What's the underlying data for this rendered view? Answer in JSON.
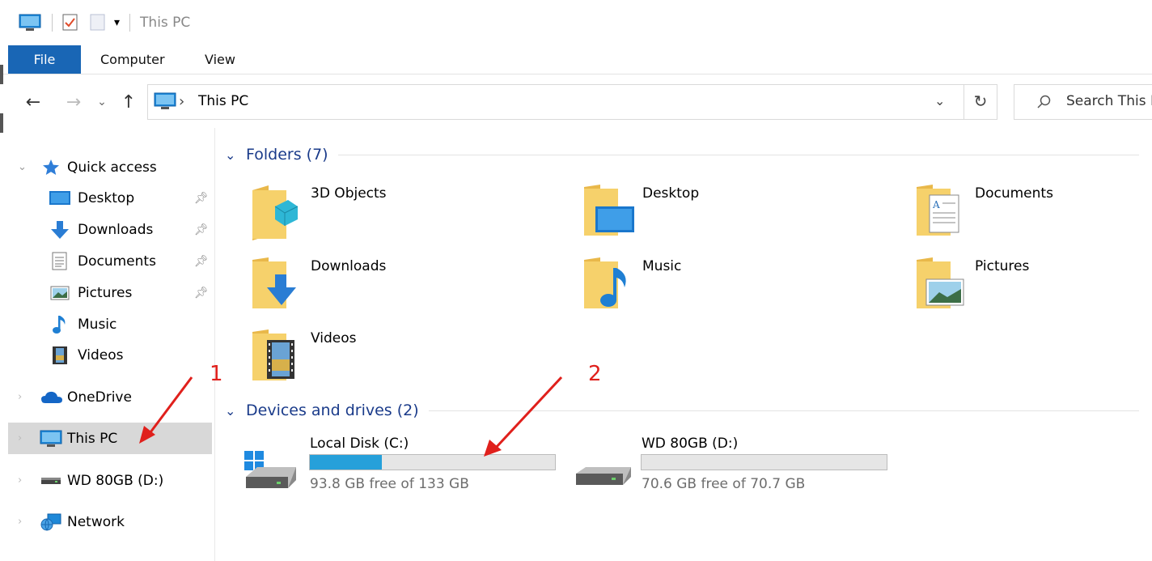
{
  "window": {
    "title": "This PC"
  },
  "ribbon": {
    "tabs": [
      "File",
      "Computer",
      "View"
    ]
  },
  "address": {
    "location": "This PC",
    "search_placeholder": "Search This PC"
  },
  "sidebar": {
    "quick_access": "Quick access",
    "quick_items": [
      {
        "label": "Desktop",
        "pinned": true,
        "icon": "desktop-icon"
      },
      {
        "label": "Downloads",
        "pinned": true,
        "icon": "downloads-icon"
      },
      {
        "label": "Documents",
        "pinned": true,
        "icon": "documents-icon"
      },
      {
        "label": "Pictures",
        "pinned": true,
        "icon": "pictures-icon"
      },
      {
        "label": "Music",
        "pinned": false,
        "icon": "music-icon"
      },
      {
        "label": "Videos",
        "pinned": false,
        "icon": "videos-icon"
      }
    ],
    "onedrive": "OneDrive",
    "this_pc": "This PC",
    "wd_drive": "WD 80GB (D:)",
    "network": "Network"
  },
  "content": {
    "folders_header": "Folders (7)",
    "folders": [
      "3D Objects",
      "Desktop",
      "Documents",
      "Downloads",
      "Music",
      "Pictures",
      "Videos"
    ],
    "devices_header": "Devices and drives (2)",
    "drives": [
      {
        "name": "Local Disk (C:)",
        "free_text": "93.8 GB free of 133 GB",
        "used_fraction": 0.295
      },
      {
        "name": "WD 80GB (D:)",
        "free_text": "70.6 GB free of 70.7 GB",
        "used_fraction": 0.0
      }
    ]
  },
  "annotations": {
    "label_1": "1",
    "label_2": "2",
    "color": "#e0201c"
  },
  "colors": {
    "accent": "#1966b5",
    "usage_bar": "#26a0da",
    "section_header": "#1a3b8a"
  }
}
